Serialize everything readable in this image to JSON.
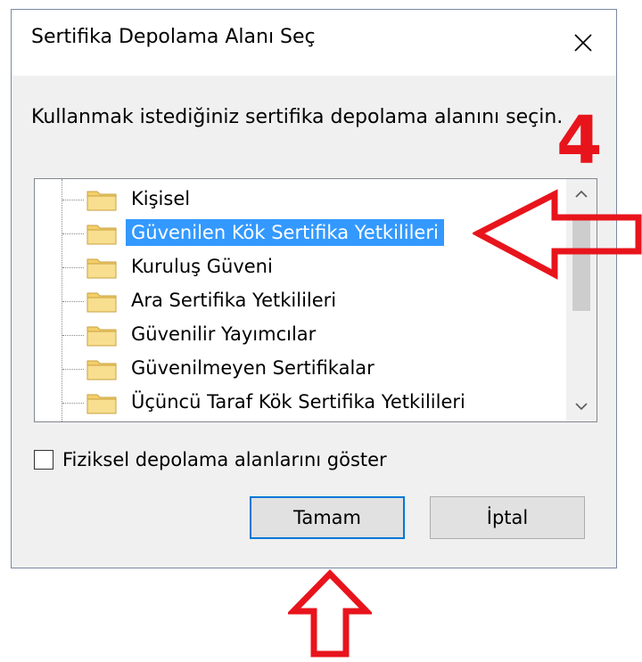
{
  "dialog": {
    "title": "Sertifika Depolama Alanı Seç",
    "instruction": "Kullanmak istediğiniz sertifika depolama alanını seçin.",
    "stores": [
      {
        "label": "Kişisel"
      },
      {
        "label": "Güvenilen Kök Sertifika Yetkilileri"
      },
      {
        "label": "Kuruluş Güveni"
      },
      {
        "label": "Ara Sertifika Yetkilileri"
      },
      {
        "label": "Güvenilir Yayımcılar"
      },
      {
        "label": "Güvenilmeyen Sertifikalar"
      },
      {
        "label": "Üçüncü Taraf Kök Sertifika Yetkilileri"
      }
    ],
    "selected_store": "Güvenilen Kök Sertifika Yetkilileri",
    "show_physical_label": "Fiziksel depolama alanlarını göster",
    "show_physical_checked": false,
    "ok_label": "Tamam",
    "cancel_label": "İptal"
  },
  "annotation": {
    "step_number": "4",
    "arrow_color": "#e8141c"
  },
  "colors": {
    "selection_bg": "#3399ff",
    "ok_border": "#0078d7"
  }
}
